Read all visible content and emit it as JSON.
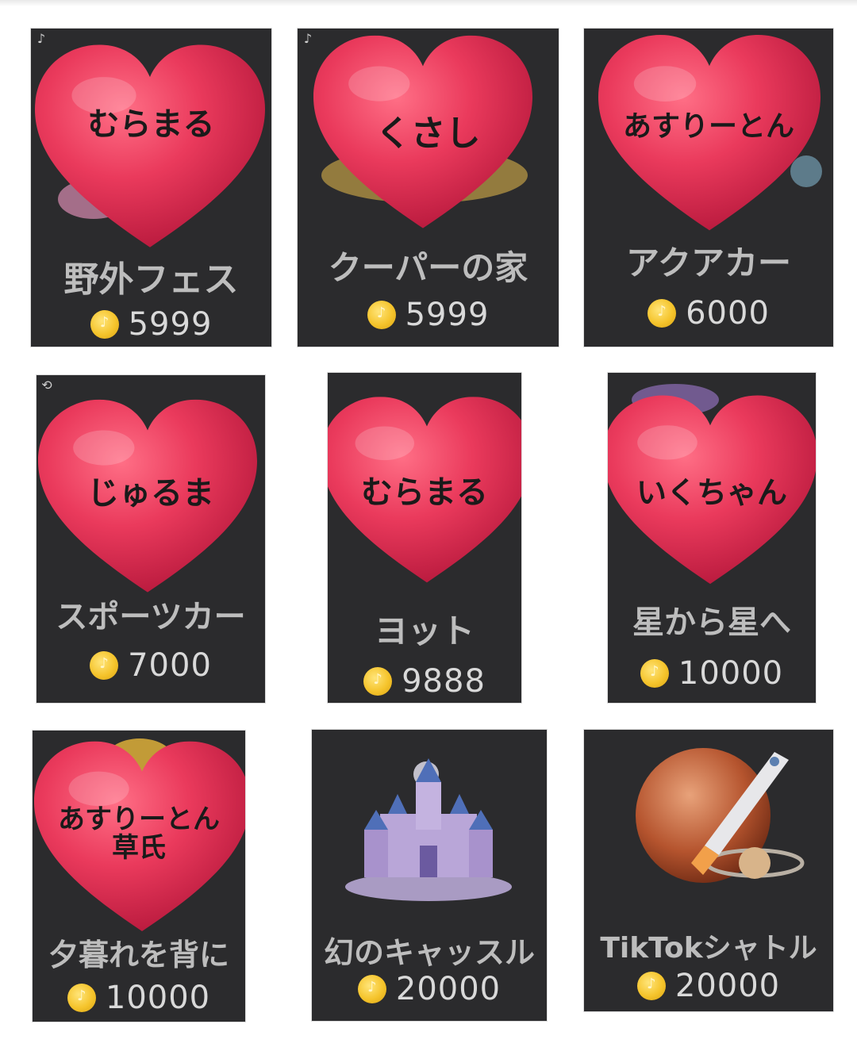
{
  "gifts": [
    {
      "name": "野外フェス",
      "price": "5999",
      "label": "むらまる"
    },
    {
      "name": "クーパーの家",
      "price": "5999",
      "label": "くさし"
    },
    {
      "name": "アクアカー",
      "price": "6000",
      "label": "あすりーとん"
    },
    {
      "name": "スポーツカー",
      "price": "7000",
      "label": "じゅるま"
    },
    {
      "name": "ヨット",
      "price": "9888",
      "label": "むらまる"
    },
    {
      "name": "星から星へ",
      "price": "10000",
      "label": "いくちゃん"
    },
    {
      "name": "夕暮れを背に",
      "price": "10000",
      "label": "あすりーとん",
      "label2": "草氏"
    },
    {
      "name": "幻のキャッスル",
      "price": "20000"
    },
    {
      "name": "TikTokシャトル",
      "price": "20000"
    }
  ],
  "colors": {
    "card_bg": "#2b2b2d",
    "heart": "#e8365a",
    "coin": "#f5c42c",
    "text": "#bdbdbd"
  },
  "icons": {
    "coin": "tiktok-coin-icon",
    "heart": "heart-sticker-icon",
    "castle": "castle-icon",
    "shuttle": "shuttle-icon"
  }
}
